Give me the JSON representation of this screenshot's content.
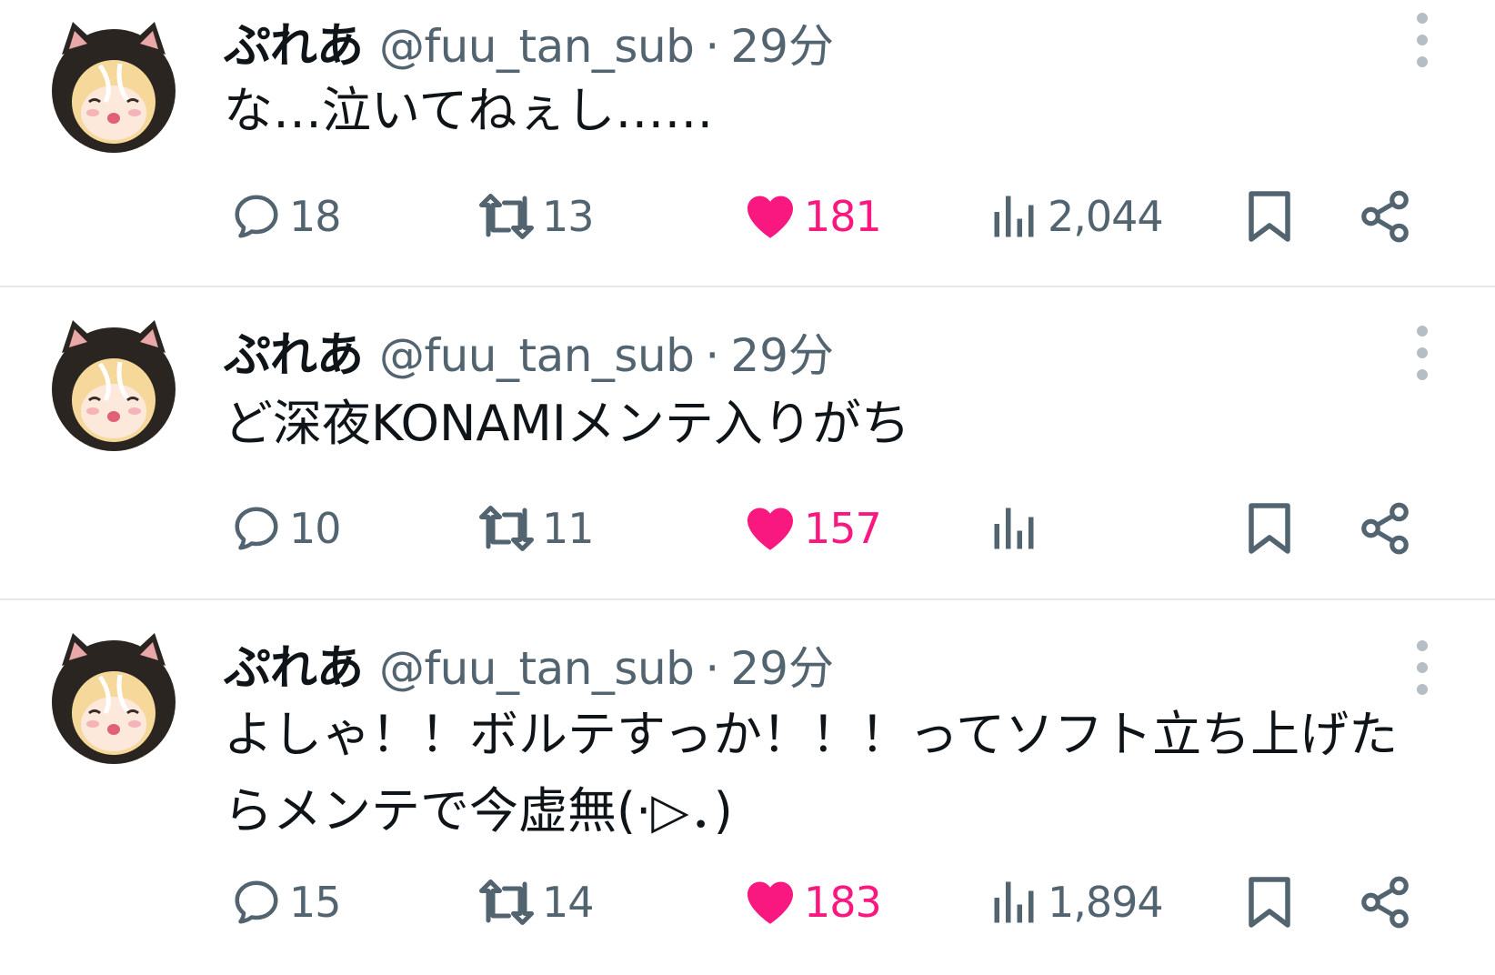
{
  "colors": {
    "text_primary": "#0f1419",
    "text_secondary": "#536471",
    "like_pink": "#f91880",
    "divider": "#e6e9eb"
  },
  "icons": [
    "avatar-cat-hood",
    "reply-icon",
    "retweet-icon",
    "heart-filled-icon",
    "views-icon",
    "bookmark-icon",
    "share-icon",
    "more-vertical-icon"
  ],
  "tweets": [
    {
      "name": "ぷれあ",
      "handle": "@fuu_tan_sub",
      "sep": "·",
      "time": "29分",
      "text": "な…泣いてねぇし……",
      "replies": "18",
      "retweets": "13",
      "likes": "181",
      "views": "2,044"
    },
    {
      "name": "ぷれあ",
      "handle": "@fuu_tan_sub",
      "sep": "·",
      "time": "29分",
      "text": "ど深夜KONAMIメンテ入りがち",
      "replies": "10",
      "retweets": "11",
      "likes": "157",
      "views": ""
    },
    {
      "name": "ぷれあ",
      "handle": "@fuu_tan_sub",
      "sep": "·",
      "time": "29分",
      "text": "よしゃ！！ボルテすっか！！！ってソフト立ち上げたらメンテで今虚無(·▷．)",
      "replies": "15",
      "retweets": "14",
      "likes": "183",
      "views": "1,894"
    }
  ]
}
